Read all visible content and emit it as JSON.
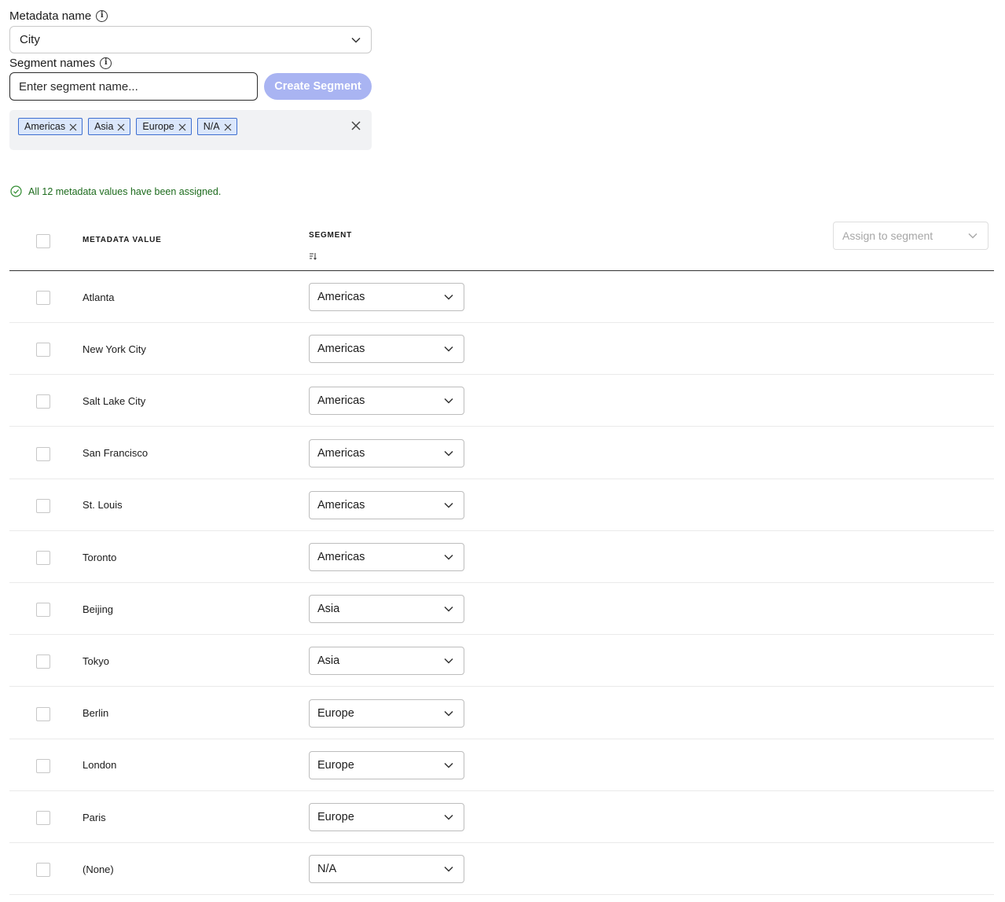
{
  "metadata": {
    "label": "Metadata name",
    "selected": "City"
  },
  "segments": {
    "label": "Segment names",
    "input_placeholder": "Enter segment name...",
    "create_label": "Create Segment",
    "chips": [
      "Americas",
      "Asia",
      "Europe",
      "N/A"
    ]
  },
  "status": {
    "message": "All 12 metadata values have been assigned.",
    "color": "#1d6b1d"
  },
  "table": {
    "col_metadata": "METADATA VALUE",
    "col_segment": "SEGMENT",
    "assign_placeholder": "Assign to segment",
    "rows": [
      {
        "value": "Atlanta",
        "segment": "Americas"
      },
      {
        "value": "New York City",
        "segment": "Americas"
      },
      {
        "value": "Salt Lake City",
        "segment": "Americas"
      },
      {
        "value": "San Francisco",
        "segment": "Americas"
      },
      {
        "value": "St. Louis",
        "segment": "Americas"
      },
      {
        "value": "Toronto",
        "segment": "Americas"
      },
      {
        "value": "Beijing",
        "segment": "Asia"
      },
      {
        "value": "Tokyo",
        "segment": "Asia"
      },
      {
        "value": "Berlin",
        "segment": "Europe"
      },
      {
        "value": "London",
        "segment": "Europe"
      },
      {
        "value": "Paris",
        "segment": "Europe"
      },
      {
        "value": "(None)",
        "segment": "N/A"
      }
    ]
  },
  "colors": {
    "accent_button": "#a9b4f2",
    "chip_bg": "#dbe7fb",
    "chip_border": "#3e6fd0"
  }
}
